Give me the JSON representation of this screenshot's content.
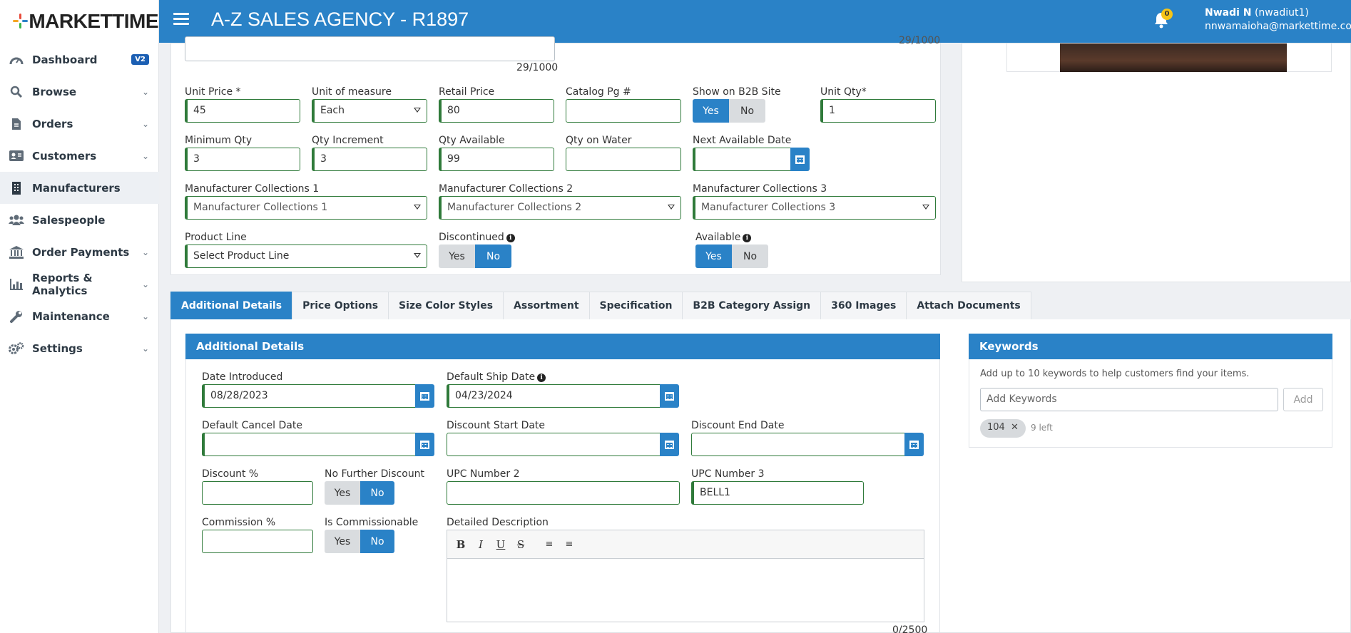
{
  "brand": {
    "logo_text": "MARKETTIME"
  },
  "sidebar": {
    "items": [
      {
        "label": "Dashboard",
        "badge": "V2"
      },
      {
        "label": "Browse"
      },
      {
        "label": "Orders"
      },
      {
        "label": "Customers"
      },
      {
        "label": "Manufacturers"
      },
      {
        "label": "Salespeople"
      },
      {
        "label": "Order Payments"
      },
      {
        "label": "Reports & Analytics"
      },
      {
        "label": "Maintenance"
      },
      {
        "label": "Settings"
      }
    ]
  },
  "header": {
    "title": "A-Z SALES AGENCY - R1897",
    "notification_count": "0",
    "user_name": "Nwadi N",
    "user_id": "(nwadiut1)",
    "user_email": "nnwamaioha@markettime.com"
  },
  "product_form": {
    "desc_counter": "29/1000",
    "right_counter": "29/1000",
    "unit_price": {
      "label": "Unit Price *",
      "value": "45"
    },
    "unit_of_measure": {
      "label": "Unit of measure",
      "value": "Each"
    },
    "retail_price": {
      "label": "Retail Price",
      "value": "80"
    },
    "catalog_pg": {
      "label": "Catalog Pg #",
      "value": ""
    },
    "show_b2b": {
      "label": "Show on B2B Site",
      "yes": "Yes",
      "no": "No"
    },
    "unit_qty": {
      "label": "Unit Qty*",
      "value": "1"
    },
    "minimum_qty": {
      "label": "Minimum Qty",
      "value": "3"
    },
    "qty_increment": {
      "label": "Qty Increment",
      "value": "3"
    },
    "qty_available": {
      "label": "Qty Available",
      "value": "99"
    },
    "qty_on_water": {
      "label": "Qty on Water",
      "value": ""
    },
    "next_available_date": {
      "label": "Next Available Date",
      "value": ""
    },
    "mfr_collections_1": {
      "label": "Manufacturer Collections 1",
      "placeholder": "Manufacturer Collections 1"
    },
    "mfr_collections_2": {
      "label": "Manufacturer Collections 2",
      "placeholder": "Manufacturer Collections 2"
    },
    "mfr_collections_3": {
      "label": "Manufacturer Collections 3",
      "placeholder": "Manufacturer Collections 3"
    },
    "product_line": {
      "label": "Product Line",
      "placeholder": "Select Product Line"
    },
    "discontinued": {
      "label": "Discontinued",
      "yes": "Yes",
      "no": "No"
    },
    "available": {
      "label": "Available",
      "yes": "Yes",
      "no": "No"
    }
  },
  "tabs": [
    "Additional Details",
    "Price Options",
    "Size Color Styles",
    "Assortment",
    "Specification",
    "B2B Category Assign",
    "360 Images",
    "Attach Documents"
  ],
  "additional_details": {
    "heading": "Additional Details",
    "date_introduced": {
      "label": "Date Introduced",
      "value": "08/28/2023"
    },
    "default_ship_date": {
      "label": "Default Ship Date",
      "value": "04/23/2024"
    },
    "default_cancel_date": {
      "label": "Default Cancel Date",
      "value": ""
    },
    "discount_start_date": {
      "label": "Discount Start Date",
      "value": ""
    },
    "discount_end_date": {
      "label": "Discount End Date",
      "value": ""
    },
    "discount_pct": {
      "label": "Discount %",
      "value": ""
    },
    "no_further_discount": {
      "label": "No Further Discount",
      "yes": "Yes",
      "no": "No"
    },
    "upc_number_2": {
      "label": "UPC Number 2",
      "value": ""
    },
    "upc_number_3": {
      "label": "UPC Number 3",
      "value": "BELL1"
    },
    "commission_pct": {
      "label": "Commission %",
      "value": ""
    },
    "is_commissionable": {
      "label": "Is Commissionable",
      "yes": "Yes",
      "no": "No"
    },
    "detailed_description": {
      "label": "Detailed Description",
      "counter": "0/2500"
    }
  },
  "keywords": {
    "heading": "Keywords",
    "help": "Add up to 10 keywords to help customers find your items.",
    "placeholder": "Add Keywords",
    "add_label": "Add",
    "tags": [
      "104"
    ],
    "remaining": "9 left"
  }
}
